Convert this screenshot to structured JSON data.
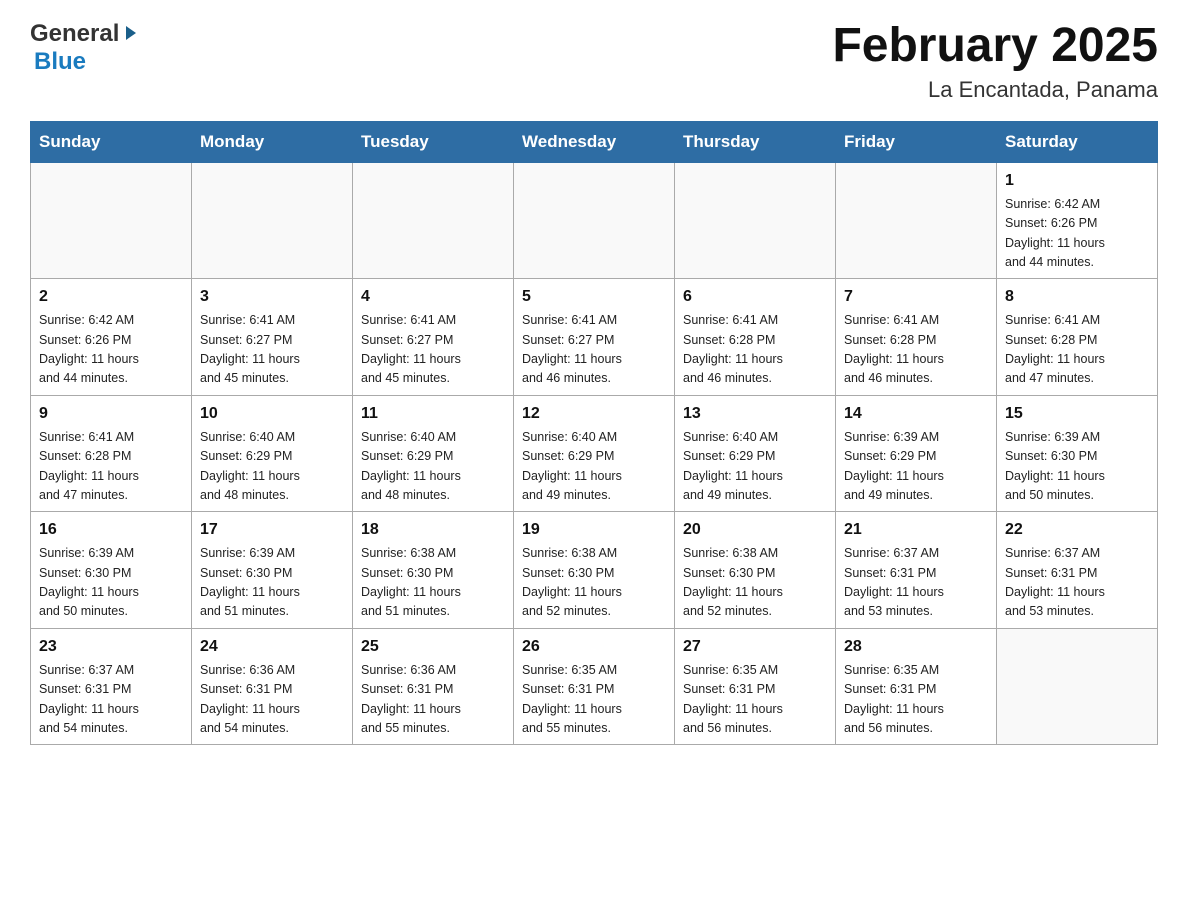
{
  "header": {
    "logo_general": "General",
    "logo_blue": "Blue",
    "month_title": "February 2025",
    "location": "La Encantada, Panama"
  },
  "weekdays": [
    "Sunday",
    "Monday",
    "Tuesday",
    "Wednesday",
    "Thursday",
    "Friday",
    "Saturday"
  ],
  "weeks": [
    [
      {
        "day": "",
        "info": ""
      },
      {
        "day": "",
        "info": ""
      },
      {
        "day": "",
        "info": ""
      },
      {
        "day": "",
        "info": ""
      },
      {
        "day": "",
        "info": ""
      },
      {
        "day": "",
        "info": ""
      },
      {
        "day": "1",
        "info": "Sunrise: 6:42 AM\nSunset: 6:26 PM\nDaylight: 11 hours\nand 44 minutes."
      }
    ],
    [
      {
        "day": "2",
        "info": "Sunrise: 6:42 AM\nSunset: 6:26 PM\nDaylight: 11 hours\nand 44 minutes."
      },
      {
        "day": "3",
        "info": "Sunrise: 6:41 AM\nSunset: 6:27 PM\nDaylight: 11 hours\nand 45 minutes."
      },
      {
        "day": "4",
        "info": "Sunrise: 6:41 AM\nSunset: 6:27 PM\nDaylight: 11 hours\nand 45 minutes."
      },
      {
        "day": "5",
        "info": "Sunrise: 6:41 AM\nSunset: 6:27 PM\nDaylight: 11 hours\nand 46 minutes."
      },
      {
        "day": "6",
        "info": "Sunrise: 6:41 AM\nSunset: 6:28 PM\nDaylight: 11 hours\nand 46 minutes."
      },
      {
        "day": "7",
        "info": "Sunrise: 6:41 AM\nSunset: 6:28 PM\nDaylight: 11 hours\nand 46 minutes."
      },
      {
        "day": "8",
        "info": "Sunrise: 6:41 AM\nSunset: 6:28 PM\nDaylight: 11 hours\nand 47 minutes."
      }
    ],
    [
      {
        "day": "9",
        "info": "Sunrise: 6:41 AM\nSunset: 6:28 PM\nDaylight: 11 hours\nand 47 minutes."
      },
      {
        "day": "10",
        "info": "Sunrise: 6:40 AM\nSunset: 6:29 PM\nDaylight: 11 hours\nand 48 minutes."
      },
      {
        "day": "11",
        "info": "Sunrise: 6:40 AM\nSunset: 6:29 PM\nDaylight: 11 hours\nand 48 minutes."
      },
      {
        "day": "12",
        "info": "Sunrise: 6:40 AM\nSunset: 6:29 PM\nDaylight: 11 hours\nand 49 minutes."
      },
      {
        "day": "13",
        "info": "Sunrise: 6:40 AM\nSunset: 6:29 PM\nDaylight: 11 hours\nand 49 minutes."
      },
      {
        "day": "14",
        "info": "Sunrise: 6:39 AM\nSunset: 6:29 PM\nDaylight: 11 hours\nand 49 minutes."
      },
      {
        "day": "15",
        "info": "Sunrise: 6:39 AM\nSunset: 6:30 PM\nDaylight: 11 hours\nand 50 minutes."
      }
    ],
    [
      {
        "day": "16",
        "info": "Sunrise: 6:39 AM\nSunset: 6:30 PM\nDaylight: 11 hours\nand 50 minutes."
      },
      {
        "day": "17",
        "info": "Sunrise: 6:39 AM\nSunset: 6:30 PM\nDaylight: 11 hours\nand 51 minutes."
      },
      {
        "day": "18",
        "info": "Sunrise: 6:38 AM\nSunset: 6:30 PM\nDaylight: 11 hours\nand 51 minutes."
      },
      {
        "day": "19",
        "info": "Sunrise: 6:38 AM\nSunset: 6:30 PM\nDaylight: 11 hours\nand 52 minutes."
      },
      {
        "day": "20",
        "info": "Sunrise: 6:38 AM\nSunset: 6:30 PM\nDaylight: 11 hours\nand 52 minutes."
      },
      {
        "day": "21",
        "info": "Sunrise: 6:37 AM\nSunset: 6:31 PM\nDaylight: 11 hours\nand 53 minutes."
      },
      {
        "day": "22",
        "info": "Sunrise: 6:37 AM\nSunset: 6:31 PM\nDaylight: 11 hours\nand 53 minutes."
      }
    ],
    [
      {
        "day": "23",
        "info": "Sunrise: 6:37 AM\nSunset: 6:31 PM\nDaylight: 11 hours\nand 54 minutes."
      },
      {
        "day": "24",
        "info": "Sunrise: 6:36 AM\nSunset: 6:31 PM\nDaylight: 11 hours\nand 54 minutes."
      },
      {
        "day": "25",
        "info": "Sunrise: 6:36 AM\nSunset: 6:31 PM\nDaylight: 11 hours\nand 55 minutes."
      },
      {
        "day": "26",
        "info": "Sunrise: 6:35 AM\nSunset: 6:31 PM\nDaylight: 11 hours\nand 55 minutes."
      },
      {
        "day": "27",
        "info": "Sunrise: 6:35 AM\nSunset: 6:31 PM\nDaylight: 11 hours\nand 56 minutes."
      },
      {
        "day": "28",
        "info": "Sunrise: 6:35 AM\nSunset: 6:31 PM\nDaylight: 11 hours\nand 56 minutes."
      },
      {
        "day": "",
        "info": ""
      }
    ]
  ]
}
